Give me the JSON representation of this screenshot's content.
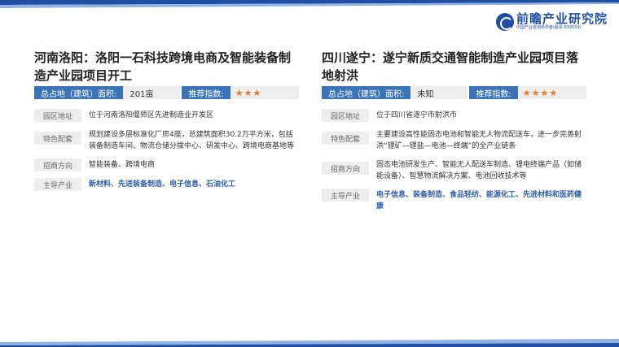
{
  "brand": {
    "name": "前瞻产业研究院",
    "subtitle": "中国产业咨询领导者(股票:839559)"
  },
  "projects": [
    {
      "title": "河南洛阳：洛阳一石科技跨境电商及智能装备制造产业园项目开工",
      "area_label": "总占地（建筑）面积:",
      "area_value": "201亩",
      "rating_label": "推荐指数:",
      "rating_stars": "★★★",
      "rating": 3,
      "rows": [
        {
          "label": "园区地址",
          "text": "位于河南洛阳偃师区先进制造业开发区"
        },
        {
          "label": "特色配套",
          "text": "规划建设多层标准化厂房4座，总建筑面积30.2万平方米，包括装备制造车间、物流仓储分拨中心、研发中心、跨境电商基地等"
        },
        {
          "label": "招商方向",
          "text": "智能装备、跨境电商"
        },
        {
          "label": "主导产业",
          "text": "新材料、先进装备制造、电子信息、石油化工"
        }
      ]
    },
    {
      "title": "四川遂宁：遂宁新质交通智能制造产业园项目落地射洪",
      "area_label": "总占地（建筑）面积:",
      "area_value": "未知",
      "rating_label": "推荐指数:",
      "rating_stars": "★★★★",
      "rating": 4,
      "rows": [
        {
          "label": "园区地址",
          "text": "位于四川省遂宁市射洪市"
        },
        {
          "label": "特色配套",
          "text": "主要建设高性能固态电池和智能无人物流配送车，进一步完善射洪“锂矿—锂盐—电池—终端”的全产业链条"
        },
        {
          "label": "招商方向",
          "text": "固态电池研发生产、智能无人配送车制造、锂电终端产品（如储能设备）、智慧物流解决方案、电池回收技术等"
        },
        {
          "label": "主导产业",
          "text": "电子信息、装备制造、食品轻纺、能源化工、先进材料和医药健康"
        }
      ]
    }
  ]
}
